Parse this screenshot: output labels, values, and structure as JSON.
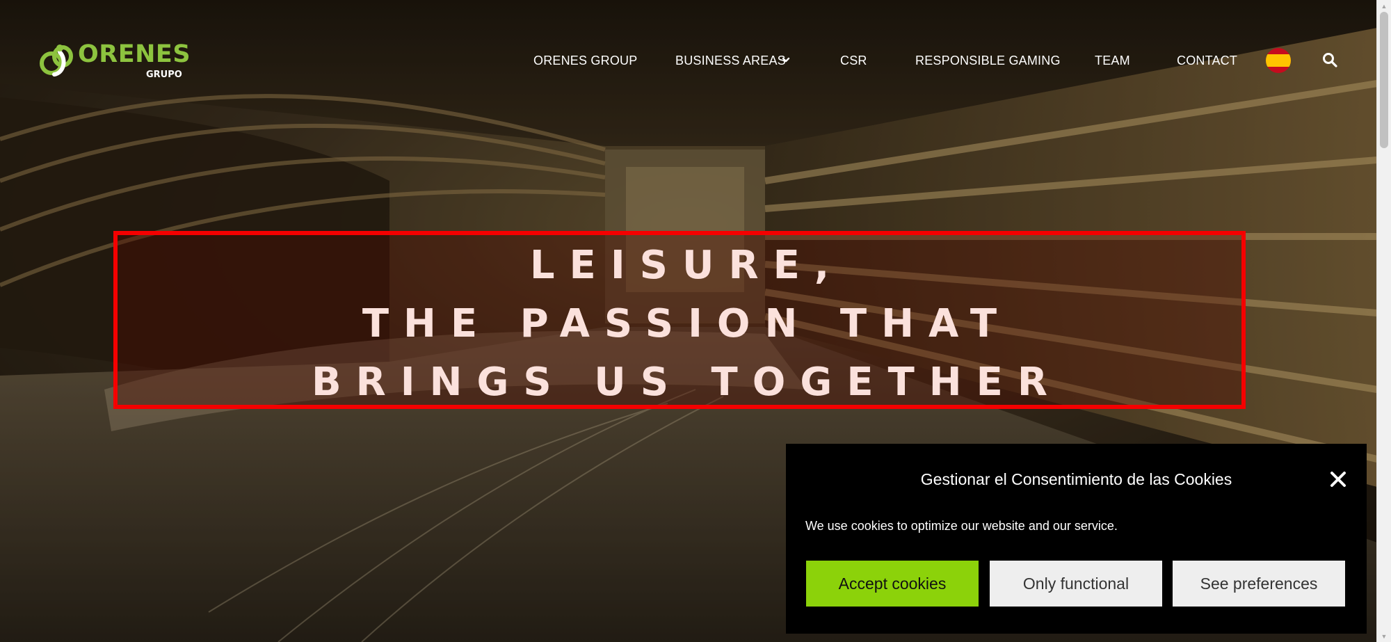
{
  "logo": {
    "word": "ORENES",
    "sub": "GRUPO",
    "brand_green": "#8dc33f"
  },
  "nav": {
    "items": [
      {
        "label": "ORENES GROUP"
      },
      {
        "label": "BUSINESS AREAS"
      },
      {
        "label": "CSR"
      },
      {
        "label": "RESPONSIBLE GAMING"
      },
      {
        "label": "TEAM"
      },
      {
        "label": "CONTACT"
      }
    ],
    "business_areas_icon": "chevron-down-icon",
    "language_icon": "spain-flag-icon",
    "search_icon": "search-icon"
  },
  "hero": {
    "line1": "LEISURE,",
    "line2": "THE PASSION THAT",
    "line3": "BRINGS US TOGETHER",
    "box_color": "#f50000"
  },
  "cookie": {
    "title": "Gestionar el Consentimiento de las Cookies",
    "text": "We use cookies to optimize our website and our service.",
    "accept_label": "Accept cookies",
    "functional_label": "Only functional",
    "preferences_label": "See preferences",
    "accent": "#8cd20a",
    "close_icon": "close-icon"
  }
}
